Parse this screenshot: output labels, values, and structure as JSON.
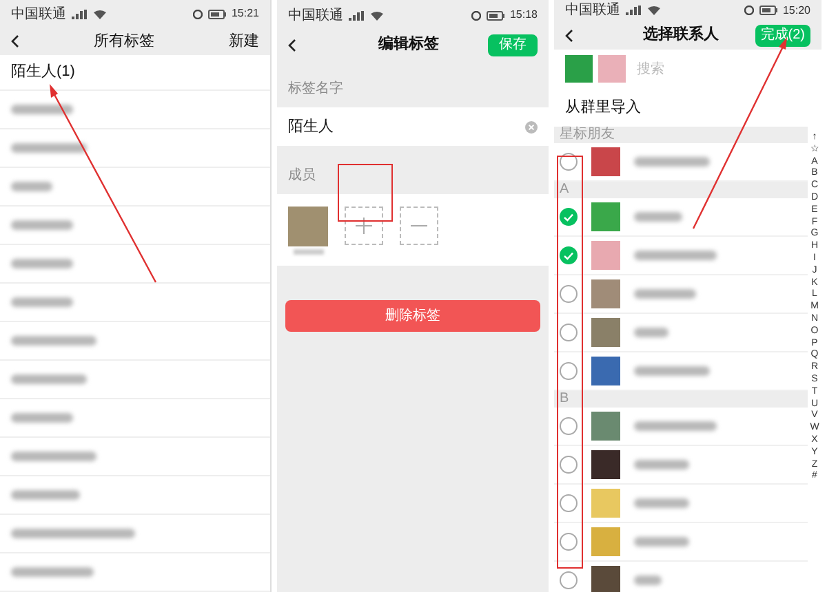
{
  "tags_screen": {
    "status_bar": {
      "carrier": "中国联通",
      "time": "15:21"
    },
    "nav": {
      "title": "所有标签",
      "action": "新建"
    },
    "tags": [
      {
        "label": "陌生人(1)"
      }
    ]
  },
  "edit_screen": {
    "status_bar": {
      "carrier": "中国联通",
      "time": "15:18"
    },
    "nav": {
      "title": "编辑标签",
      "action": "保存"
    },
    "name_label": "标签名字",
    "name_value": "陌生人",
    "members_label": "成员",
    "delete_button": "删除标签"
  },
  "contacts_screen": {
    "status_bar": {
      "carrier": "中国联通",
      "time": "15:20"
    },
    "nav": {
      "title": "选择联系人",
      "action": "完成(2)"
    },
    "search": {
      "placeholder": "搜索"
    },
    "import_label": "从群里导入",
    "sections": [
      {
        "header": "星标朋友",
        "contacts": [
          {
            "selected": false
          }
        ]
      },
      {
        "header": "A",
        "contacts": [
          {
            "selected": true
          },
          {
            "selected": true
          },
          {
            "selected": false
          },
          {
            "selected": false
          },
          {
            "selected": false
          }
        ]
      },
      {
        "header": "B",
        "contacts": [
          {
            "selected": false
          },
          {
            "selected": false
          },
          {
            "selected": false
          },
          {
            "selected": false
          },
          {
            "selected": false
          }
        ]
      }
    ],
    "index": [
      "↑",
      "☆",
      "A",
      "B",
      "C",
      "D",
      "E",
      "F",
      "G",
      "H",
      "I",
      "J",
      "K",
      "L",
      "M",
      "N",
      "O",
      "P",
      "Q",
      "R",
      "S",
      "T",
      "U",
      "V",
      "W",
      "X",
      "Y",
      "Z",
      "#"
    ]
  }
}
